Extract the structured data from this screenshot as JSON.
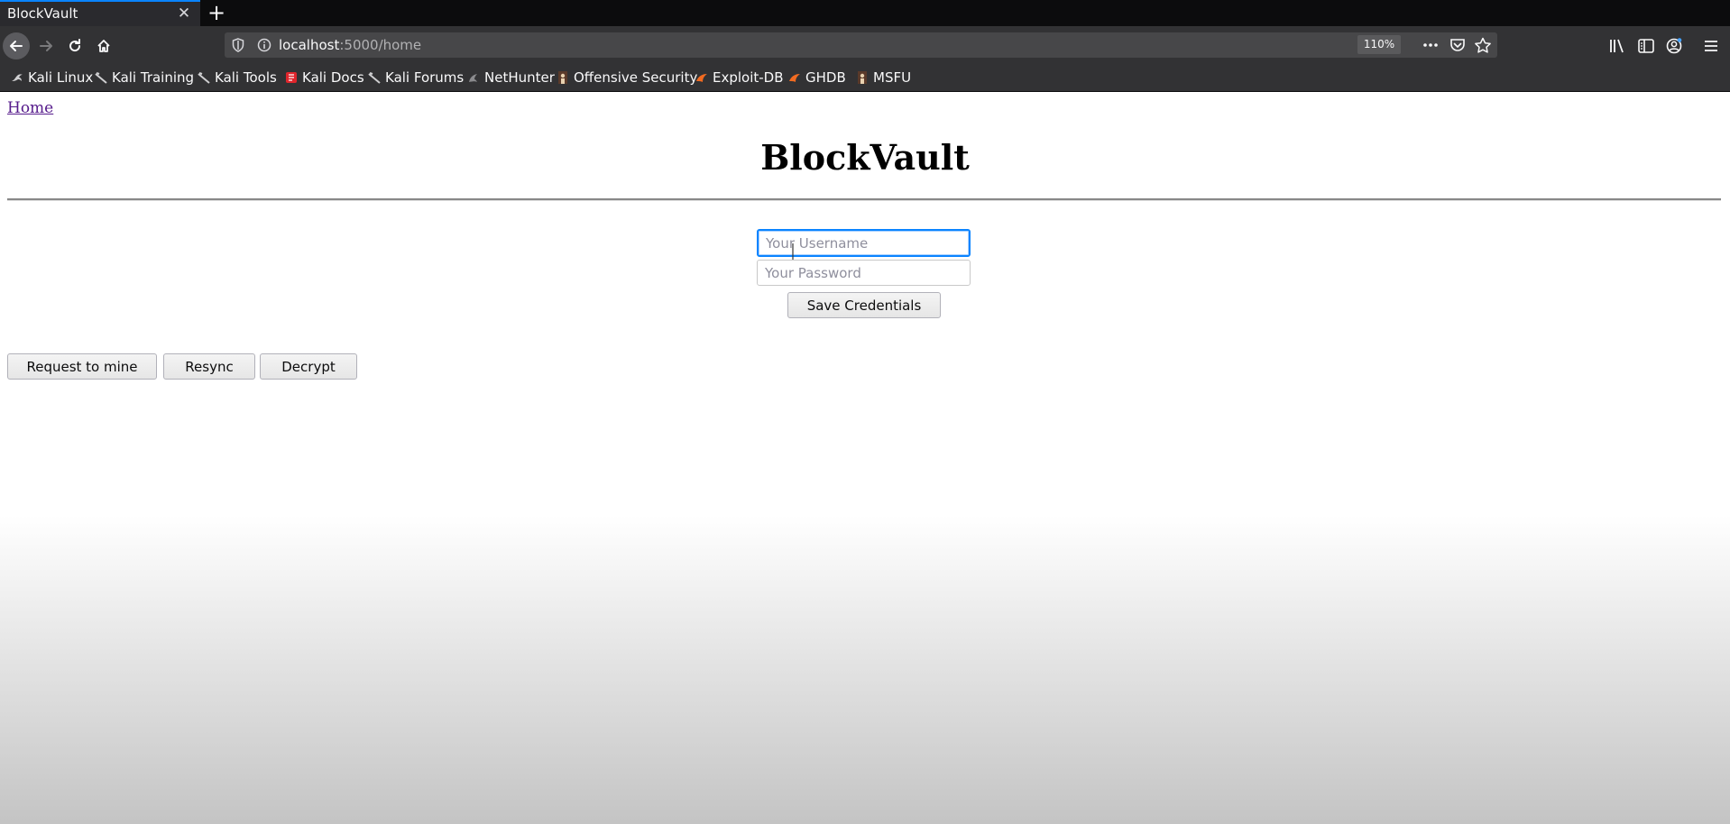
{
  "browser": {
    "tab": {
      "title": "BlockVault",
      "close_icon": "close-icon"
    },
    "new_tab_symbol": "+",
    "url": {
      "host": "localhost",
      "rest": ":5000/home"
    },
    "zoom": "110%",
    "accent_color": "#0a84ff"
  },
  "bookmarks": [
    {
      "label": "Kali Linux",
      "icon": "kali-dragon-icon"
    },
    {
      "label": "Kali Training",
      "icon": "kali-dragon-icon"
    },
    {
      "label": "Kali Tools",
      "icon": "kali-dragon-icon"
    },
    {
      "label": "Kali Docs",
      "icon": "kali-docs-icon"
    },
    {
      "label": "Kali Forums",
      "icon": "kali-dragon-icon"
    },
    {
      "label": "NetHunter",
      "icon": "nethunter-icon"
    },
    {
      "label": "Offensive Security",
      "icon": "offsec-icon"
    },
    {
      "label": "Exploit-DB",
      "icon": "exploitdb-icon"
    },
    {
      "label": "GHDB",
      "icon": "exploitdb-icon"
    },
    {
      "label": "MSFU",
      "icon": "offsec-icon"
    }
  ],
  "page": {
    "home_link": "Home",
    "title": "BlockVault",
    "username_placeholder": "Your Username",
    "password_placeholder": "Your Password",
    "save_label": "Save Credentials",
    "actions": [
      "Request to mine",
      "Resync",
      "Decrypt"
    ]
  }
}
